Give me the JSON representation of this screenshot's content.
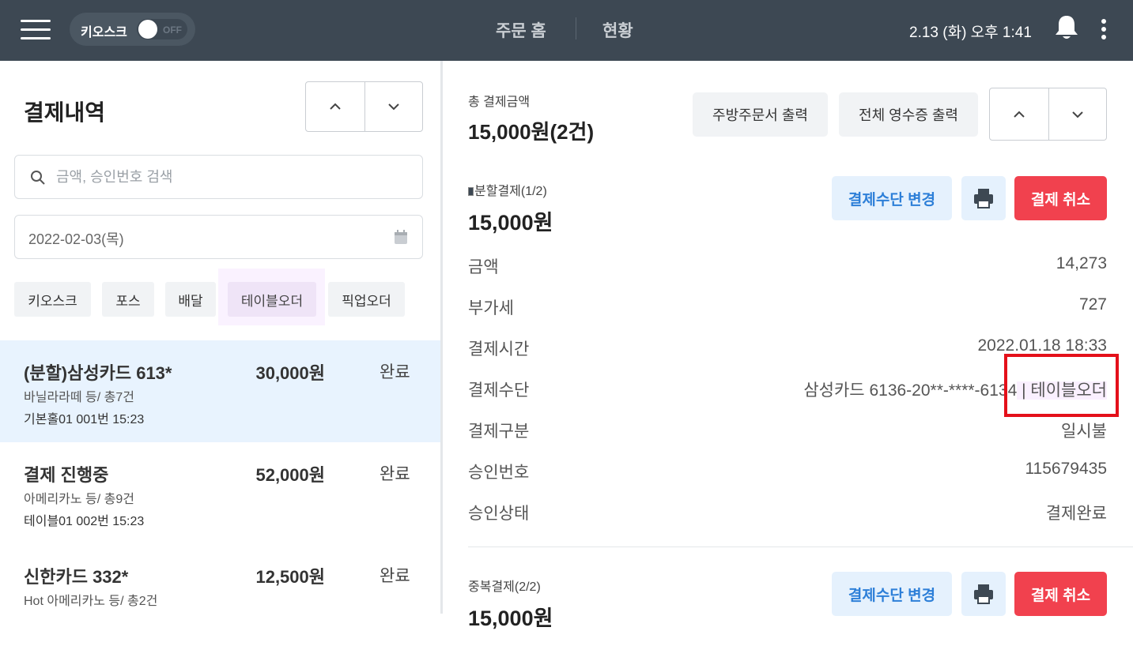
{
  "topbar": {
    "kiosk_label": "키오스크",
    "kiosk_toggle_state": "OFF",
    "nav_home": "주문 홈",
    "nav_status": "현황",
    "datetime": "2.13 (화) 오후 1:41"
  },
  "left": {
    "title": "결제내역",
    "search_placeholder": "금액, 승인번호 검색",
    "date": "2022-02-03(목)",
    "filters": [
      "키오스크",
      "포스",
      "배달",
      "테이블오더",
      "픽업오더"
    ],
    "active_filter": "테이블오더",
    "orders": [
      {
        "name": "(분할)삼성카드 613*",
        "amount": "30,000원",
        "status": "완료",
        "items": "바닐라라떼 등/ 총7건",
        "place": "기본홀01 001번 15:23",
        "selected": true
      },
      {
        "name": "결제 진행중",
        "amount": "52,000원",
        "status": "완료",
        "items": "아메리카노 등/ 총9건",
        "place": "테이블01 002번 15:23",
        "selected": false
      },
      {
        "name": "신한카드 332*",
        "amount": "12,500원",
        "status": "완료",
        "items": "Hot 아메리카노 등/ 총2건",
        "place": "",
        "selected": false
      }
    ]
  },
  "right": {
    "total_label": "총 결제금액",
    "total_value": "15,000원(2건)",
    "kitchen_print": "주방주문서 출력",
    "all_receipt_print": "전체 영수증 출력",
    "payment1": {
      "label": "분할결제(1/2)",
      "amount": "15,000원",
      "change_method": "결제수단 변경",
      "cancel": "결제 취소",
      "rows": [
        {
          "label": "금액",
          "value": "14,273"
        },
        {
          "label": "부가세",
          "value": "727"
        },
        {
          "label": "결제시간",
          "value": "2022.01.18 18:33"
        },
        {
          "label": "결제수단",
          "value": "삼성카드 6136-20**-****-6134",
          "value_extra": "테이블오더"
        },
        {
          "label": "결제구분",
          "value": "일시불"
        },
        {
          "label": "승인번호",
          "value": "115679435"
        },
        {
          "label": "승인상태",
          "value": "결제완료"
        }
      ]
    },
    "payment2": {
      "label": "중복결제(2/2)",
      "amount": "15,000원",
      "change_method": "결제수단 변경",
      "cancel": "결제 취소"
    }
  },
  "colors": {
    "topbar_bg": "#3d4853",
    "selected_row_bg": "#e8f3fe",
    "cancel_red": "#f1414e",
    "action_blue": "#2d7fd8",
    "highlight_box": "#e4101a"
  },
  "icons": [
    "hamburger-icon",
    "toggle-switch",
    "bell-icon",
    "kebab-menu-icon",
    "chevron-up-icon",
    "chevron-down-icon",
    "search-icon",
    "calendar-icon",
    "printer-icon"
  ]
}
